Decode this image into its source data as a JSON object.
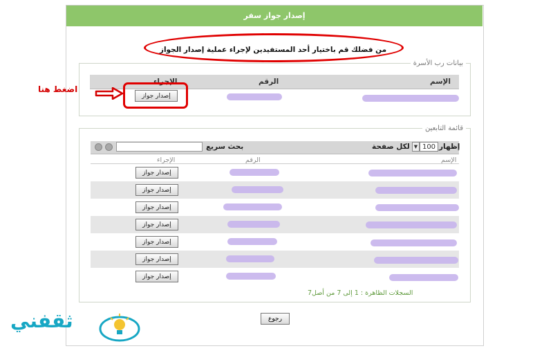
{
  "window_title": "إصدار جواز سفر",
  "instruction": "من فضلك قم باختيار أحد المستفيدين لإجراء عملية إصدار الجواز",
  "family_head": {
    "legend": "بيانات رب الأسرة",
    "col_name": "الإسم",
    "col_number": "الرقم",
    "col_action": "الإجراء",
    "button_label": "إصدار جواز"
  },
  "dependents": {
    "legend": "قائمة التابعين",
    "show_label": "إظهار",
    "page_size": "100",
    "per_page_label": "لكل صفحة",
    "quick_search_label": "بحث سريع",
    "quick_search_value": "",
    "col_name": "الإسم",
    "col_number": "الرقم",
    "col_action": "الإجراء",
    "rows": [
      {
        "button_label": "إصدار جواز"
      },
      {
        "button_label": "إصدار جواز"
      },
      {
        "button_label": "إصدار جواز"
      },
      {
        "button_label": "إصدار جواز"
      },
      {
        "button_label": "إصدار جواز"
      },
      {
        "button_label": "إصدار جواز"
      },
      {
        "button_label": "إصدار جواز"
      }
    ],
    "records_text": "السجلات الظاهرة : 1 إلى 7 من أصل7"
  },
  "back_button": "رجوع",
  "annotation_press_here": "اضغط هنا",
  "logo_text": "ثقفني",
  "colors": {
    "title_bar": "#8ec66a",
    "highlight": "#e00000",
    "redacted": "#c7b4ec",
    "logo": "#17a7c4"
  }
}
